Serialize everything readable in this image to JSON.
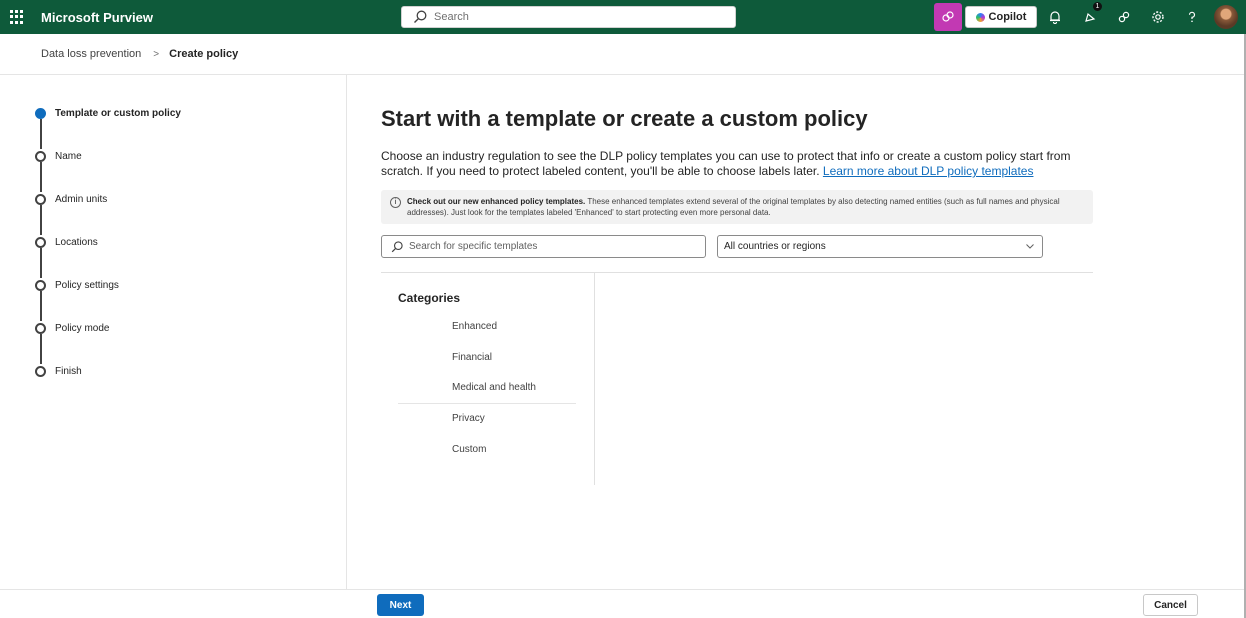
{
  "topbar": {
    "app_name": "Microsoft Purview",
    "search_placeholder": "Search",
    "copilot_label": "Copilot",
    "notification_count": "1",
    "icons": [
      "waffle-icon",
      "search-icon",
      "security-copilot-icon",
      "copilot-icon",
      "bell-icon",
      "megaphone-icon",
      "people-icon",
      "gear-icon",
      "help-icon",
      "avatar"
    ],
    "bar_color": "#0e5a3a",
    "accent_magenta": "#c239b3"
  },
  "breadcrumb": {
    "items": [
      "Data loss prevention",
      "Create policy"
    ],
    "separator": ">"
  },
  "steps": [
    {
      "label": "Template or custom policy",
      "active": true
    },
    {
      "label": "Name",
      "active": false
    },
    {
      "label": "Admin units",
      "active": false
    },
    {
      "label": "Locations",
      "active": false
    },
    {
      "label": "Policy settings",
      "active": false
    },
    {
      "label": "Policy mode",
      "active": false
    },
    {
      "label": "Finish",
      "active": false
    }
  ],
  "main": {
    "title": "Start with a template or create a custom policy",
    "description": "Choose an industry regulation to see the DLP policy templates you can use to protect that info or create a custom policy start from scratch. If you need to protect labeled content, you'll be able to choose labels later. ",
    "learn_more_link": "Learn more about DLP policy templates",
    "info_bold": "Check out our new enhanced policy templates.",
    "info_text": " These enhanced templates extend several of the original templates by also detecting named entities (such as full names and physical addresses). Just look for the templates labeled 'Enhanced' to start protecting even more personal data.",
    "template_search_placeholder": "Search for specific templates",
    "region_selected": "All countries or regions",
    "categories_heading": "Categories",
    "categories": [
      "Enhanced",
      "Financial",
      "Medical and health",
      "Privacy",
      "Custom"
    ]
  },
  "footer": {
    "next_label": "Next",
    "cancel_label": "Cancel"
  },
  "colors": {
    "primary": "#0f6cbd",
    "step_active": "#0f6cbd"
  }
}
